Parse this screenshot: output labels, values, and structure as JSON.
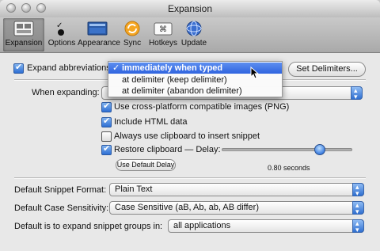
{
  "window": {
    "title": "Expansion"
  },
  "toolbar": {
    "items": [
      {
        "label": "Expansion",
        "icon": "expansion-icon",
        "selected": true
      },
      {
        "label": "Options",
        "icon": "options-icon"
      },
      {
        "label": "Appearance",
        "icon": "appearance-icon"
      },
      {
        "label": "Sync",
        "icon": "sync-icon"
      },
      {
        "label": "Hotkeys",
        "icon": "hotkeys-icon"
      },
      {
        "label": "Update",
        "icon": "update-icon"
      }
    ]
  },
  "expand": {
    "checkbox_label": "Expand abbreviations",
    "checked": true,
    "selected_option": "immediately when typed",
    "options": [
      "immediately when typed",
      "at delimiter (keep delimiter)",
      "at delimiter (abandon delimiter)"
    ],
    "set_delimiters_button": "Set Delimiters..."
  },
  "when_expanding": {
    "label": "When expanding:",
    "options": [
      {
        "label": "Use cross-platform compatible images (PNG)",
        "checked": true
      },
      {
        "label": "Include HTML data",
        "checked": true
      },
      {
        "label": "Always use clipboard to insert snippet",
        "checked": false
      },
      {
        "label": "Restore clipboard — Delay:",
        "checked": true
      }
    ],
    "default_delay_button": "Use Default Delay",
    "delay_value": "0.80 seconds",
    "delay_fraction": 0.75
  },
  "defaults": {
    "snippet_format_label": "Default Snippet Format:",
    "snippet_format_value": "Plain Text",
    "case_label": "Default Case Sensitivity:",
    "case_value": "Case Sensitive (aB, Ab, ab, AB differ)",
    "groups_label": "Default is to expand snippet groups in:",
    "groups_value": "all applications"
  },
  "colors": {
    "accent": "#2f63df",
    "checkbox_on": "#2e6fd3"
  }
}
